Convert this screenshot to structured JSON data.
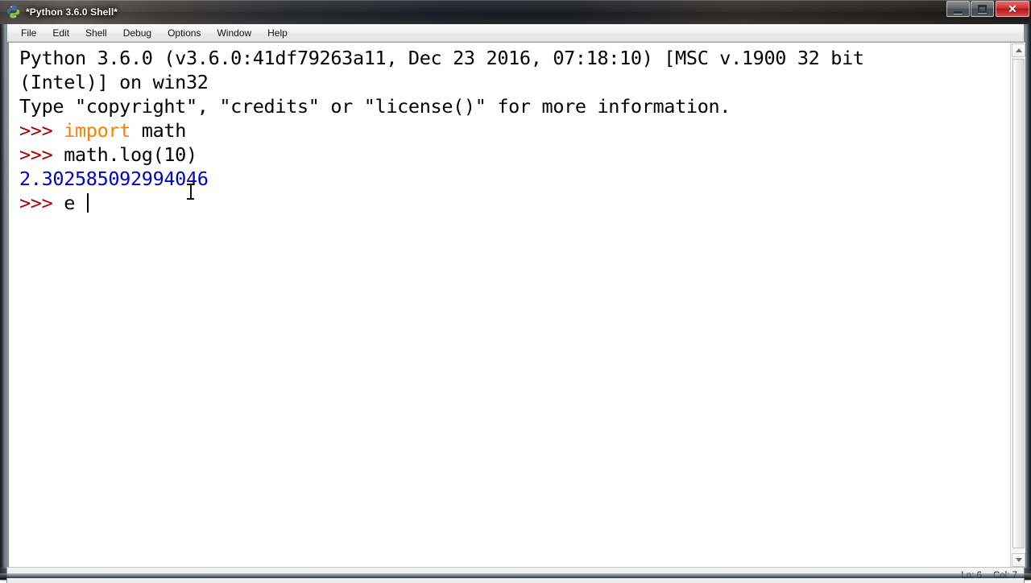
{
  "window": {
    "title": "*Python 3.6.0 Shell*",
    "icon": "python-idle-icon",
    "controls": {
      "minimize_label": "Minimize",
      "maximize_label": "Maximize",
      "close_label": "Close",
      "close_glyph": "✕",
      "close_color": "#c92a2a"
    }
  },
  "menubar": {
    "items": [
      {
        "label": "File"
      },
      {
        "label": "Edit"
      },
      {
        "label": "Shell"
      },
      {
        "label": "Debug"
      },
      {
        "label": "Options"
      },
      {
        "label": "Window"
      },
      {
        "label": "Help"
      }
    ]
  },
  "console": {
    "colors": {
      "prompt": "#aa0000",
      "keyword": "#ff8000",
      "output": "#0000cc",
      "plain": "#000000",
      "background": "#ffffff"
    },
    "lines": [
      {
        "spans": [
          {
            "style": "plain",
            "text": "Python 3.6.0 (v3.6.0:41df79263a11, Dec 23 2016, 07:18:10) [MSC v.1900 32 bit"
          }
        ]
      },
      {
        "spans": [
          {
            "style": "plain",
            "text": "(Intel)] on win32"
          }
        ]
      },
      {
        "spans": [
          {
            "style": "plain",
            "text": "Type \"copyright\", \"credits\" or \"license()\" for more information."
          }
        ]
      },
      {
        "spans": [
          {
            "style": "prompt",
            "text": ">>> "
          },
          {
            "style": "keyword",
            "text": "import"
          },
          {
            "style": "plain",
            "text": " math"
          }
        ]
      },
      {
        "spans": [
          {
            "style": "prompt",
            "text": ">>> "
          },
          {
            "style": "plain",
            "text": "math.log(10)"
          }
        ]
      },
      {
        "spans": [
          {
            "style": "output",
            "text": "2.302585092994046"
          }
        ]
      },
      {
        "spans": [
          {
            "style": "prompt",
            "text": ">>> "
          },
          {
            "style": "plain",
            "text": "e "
          }
        ],
        "caret": true
      }
    ]
  },
  "scrollbar": {
    "up_arrow": "scroll-up-arrow",
    "down_arrow": "scroll-down-arrow",
    "thumb": "scroll-thumb"
  },
  "statusbar": {
    "line_label": "Ln: 6",
    "col_label": "Col: 7"
  }
}
